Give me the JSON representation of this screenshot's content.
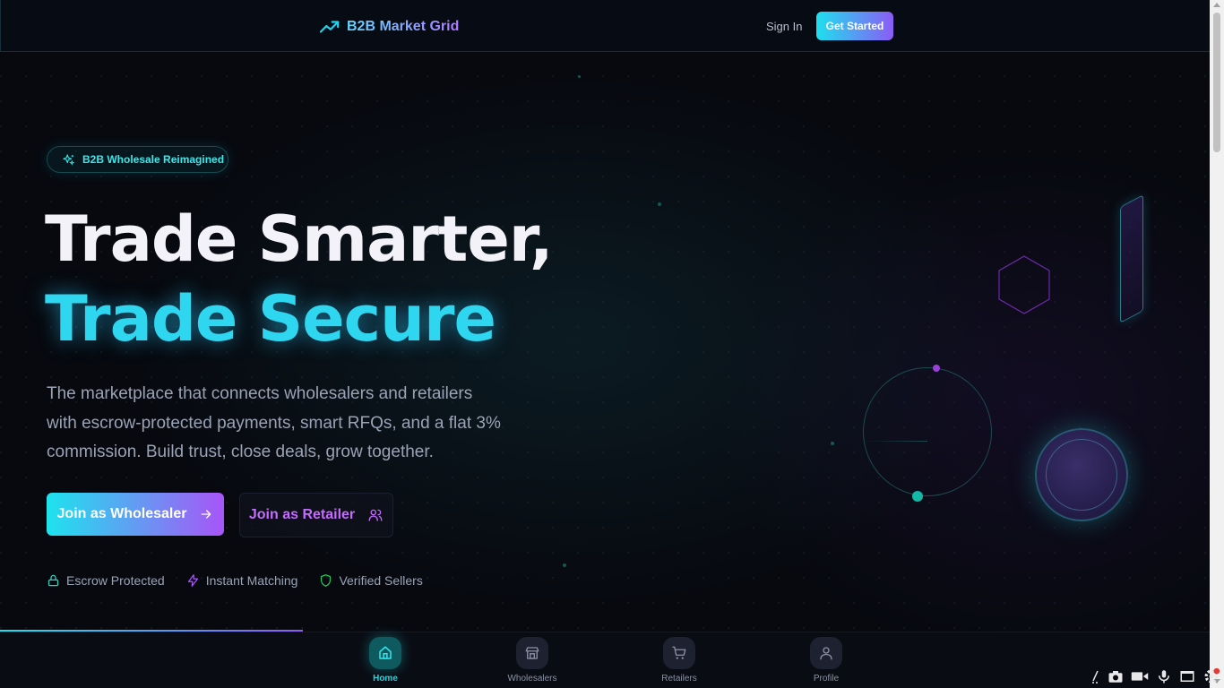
{
  "header": {
    "brand_name": "B2B Market Grid",
    "sign_in_label": "Sign In",
    "get_started_label": "Get Started"
  },
  "hero": {
    "badge_text": "B2B Wholesale Reimagined",
    "headline_line1": "Trade Smarter,",
    "headline_line2": "Trade Secure",
    "description": "The marketplace that connects wholesalers and retailers with escrow-protected payments, smart RFQs, and a flat 3% commission. Build trust, close deals, grow together.",
    "primary_cta": "Join as Wholesaler",
    "secondary_cta": "Join as Retailer",
    "features": [
      {
        "label": "Escrow Protected",
        "icon": "lock-icon"
      },
      {
        "label": "Instant Matching",
        "icon": "zap-icon"
      },
      {
        "label": "Verified Sellers",
        "icon": "shield-icon"
      }
    ]
  },
  "bottom_nav": {
    "items": [
      {
        "label": "Home",
        "icon": "home-icon",
        "active": true
      },
      {
        "label": "Wholesalers",
        "icon": "store-icon",
        "active": false
      },
      {
        "label": "Retailers",
        "icon": "cart-icon",
        "active": false
      },
      {
        "label": "Profile",
        "icon": "user-icon",
        "active": false
      }
    ]
  },
  "colors": {
    "background": "#07090f",
    "accent_cyan": "#1ee0ee",
    "accent_purple": "#8b5cf6",
    "text_muted": "#9aa3b5"
  }
}
